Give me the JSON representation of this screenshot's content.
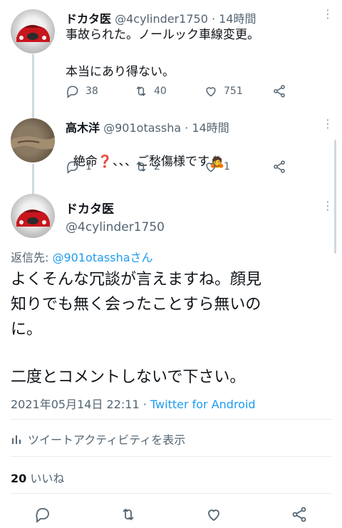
{
  "tweets": [
    {
      "name": "ドカタ医",
      "handle": "@4cylinder1750",
      "time": "· 14時間",
      "text": "事故られた。ノールック車線変更。\n\n本当にあり得ない。",
      "replies": "38",
      "retweets": "40",
      "likes": "751"
    },
    {
      "name": "高木洋",
      "handle": "@901otassha",
      "time": "· 14時間",
      "text_before": "絶命",
      "text_mark": "❓",
      "text_after": "、、、ご愁傷様です",
      "emoji": "🙇",
      "replies": "1",
      "retweets": "2",
      "likes": "1"
    }
  ],
  "main_tweet": {
    "name": "ドカタ医",
    "handle": "@4cylinder1750",
    "reply_prefix": "返信先: ",
    "reply_target": "@901otasshaさん",
    "text": "よくそんな冗談が言えますね。顔見\n知りでも無く会ったことすら無いの\nに。",
    "text2": "二度とコメントしないで下さい。",
    "timestamp": "2021年05月14日 22:11 · ",
    "source": "Twitter for Android",
    "activity_label": "ツイートアクティビティを表示",
    "like_count": "20",
    "like_label": " いいね"
  },
  "icons": [
    "reply-icon",
    "retweet-icon",
    "like-icon",
    "share-icon",
    "more-icon",
    "activity-icon"
  ],
  "colors": {
    "link": "#1d9bf0",
    "muted": "#536471",
    "text": "#0f1419",
    "divider": "#e6ecf0"
  }
}
